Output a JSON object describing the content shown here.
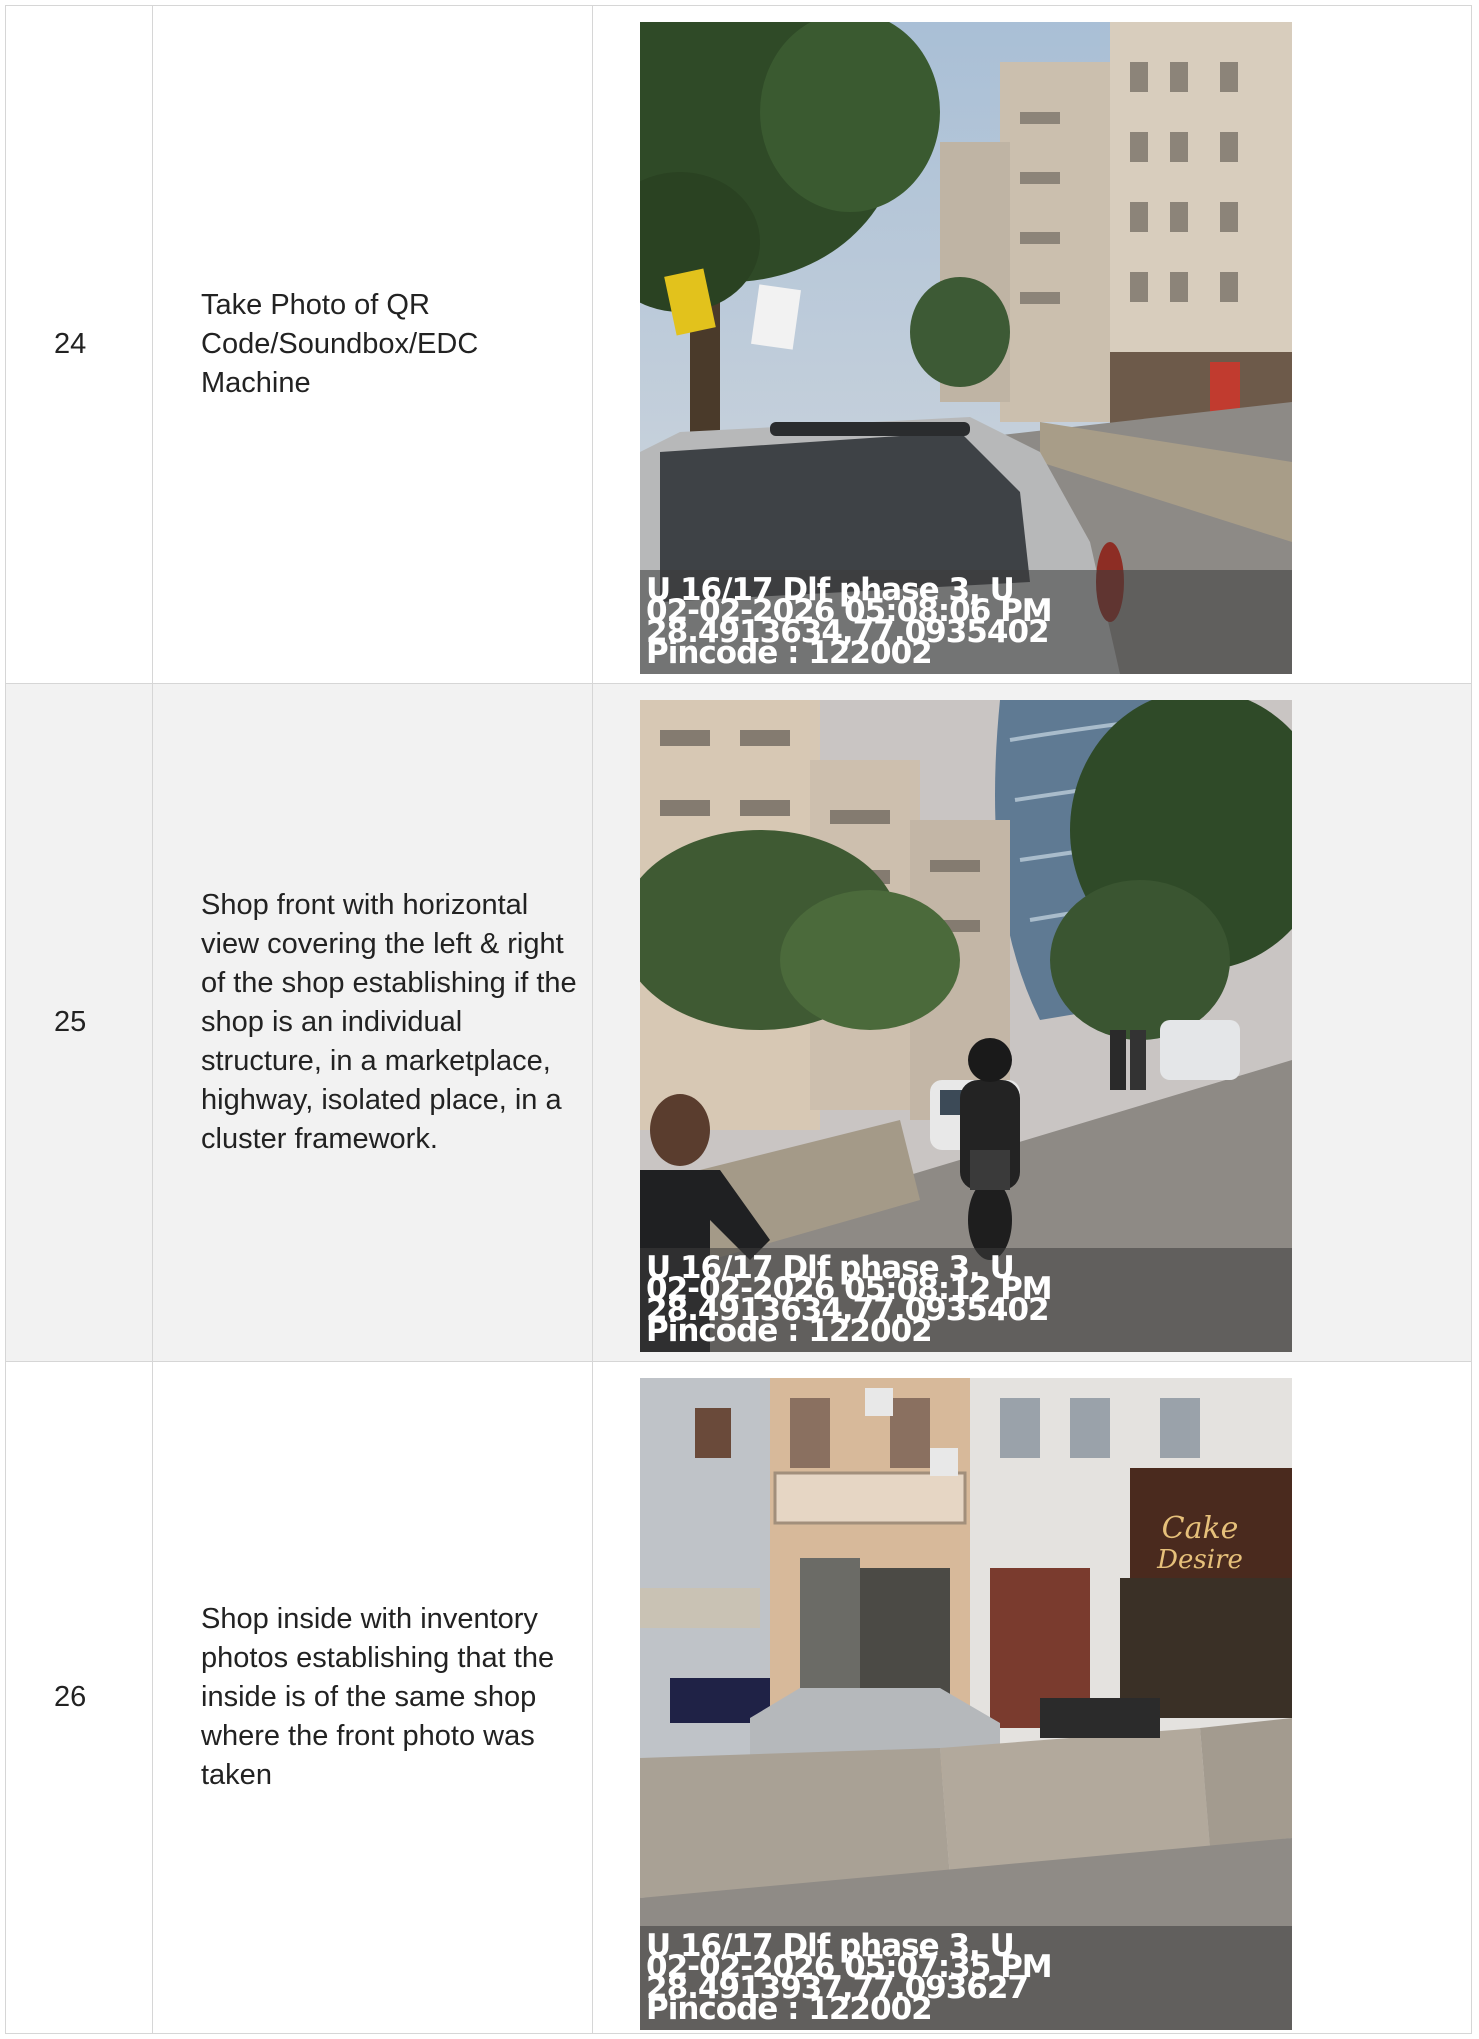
{
  "rows": [
    {
      "number": "24",
      "description": "Take Photo of QR Code/Soundbox/EDC Machine",
      "photo": {
        "scene": "street-with-car",
        "stamp_line1": "U 16/17 Dlf phase 3, U",
        "stamp_line2": "02-02-2026 05:08:06 PM",
        "stamp_line3": "28.4913634,77.0935402",
        "stamp_line4": "Pincode : 122002"
      }
    },
    {
      "number": "25",
      "description": "Shop front with horizontal view covering the left & right of the shop establishing if the shop is an individual structure, in a marketplace, highway, isolated place, in a cluster framework.",
      "photo": {
        "scene": "street-with-motorcycle",
        "stamp_line1": "U 16/17 Dlf phase 3, U",
        "stamp_line2": "02-02-2026 05:08:12 PM",
        "stamp_line3": "28.4913634,77.0935402",
        "stamp_line4": "Pincode : 122002"
      }
    },
    {
      "number": "26",
      "description": "Shop inside with inventory photos establishing that the inside is of the same shop where the front photo was taken",
      "photo": {
        "scene": "shopfront-with-barrier",
        "stamp_line1": "U 16/17 Dlf phase 3, U",
        "stamp_line2": "02-02-2026 05:07:35 PM",
        "stamp_line3": "28.4913937,77.093627",
        "stamp_line4": "Pincode : 122002"
      }
    }
  ]
}
